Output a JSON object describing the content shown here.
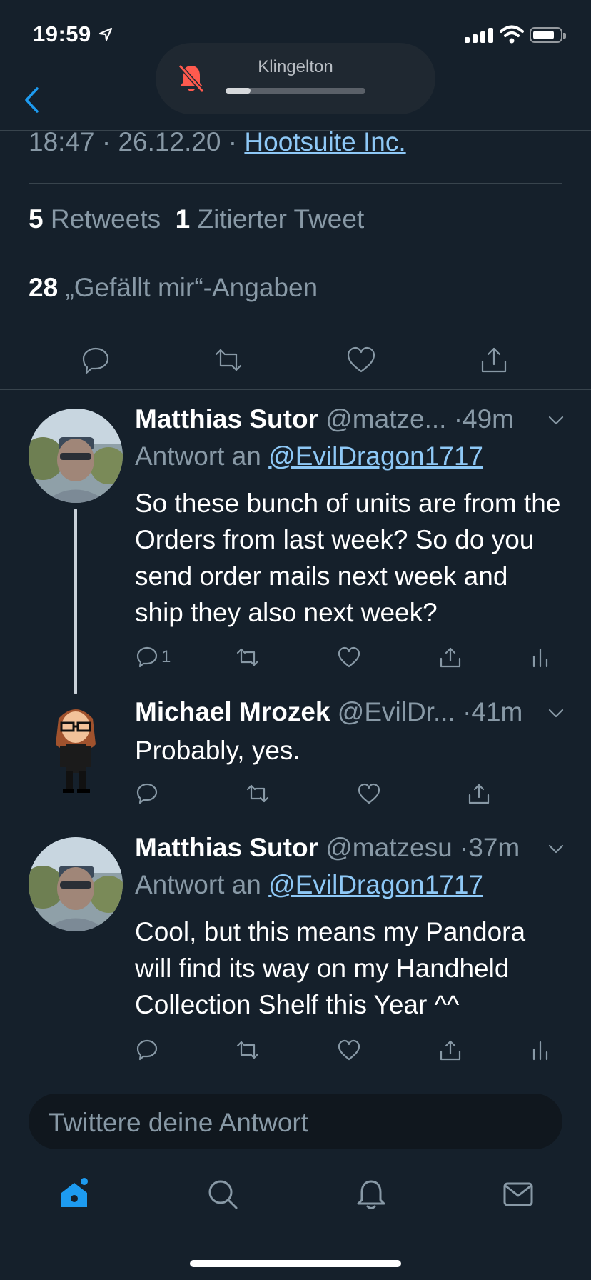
{
  "status_bar": {
    "time": "19:59",
    "battery_level": 0.75
  },
  "ringer": {
    "label": "Klingelton",
    "level": 0.18
  },
  "tweet_meta": {
    "time": "18:47",
    "separator": "·",
    "date": "26.12.20",
    "source": "Hootsuite Inc."
  },
  "stats": {
    "retweets_count": "5",
    "retweets_label": "Retweets",
    "quotes_count": "1",
    "quotes_label": "Zitierter Tweet",
    "likes_count": "28",
    "likes_label": "„Gefällt mir“-Angaben"
  },
  "replies": [
    {
      "name": "Matthias Sutor",
      "handle": "@matze...",
      "dot": "·",
      "time": "49m",
      "replying_prefix": "Antwort an",
      "replying_to": "@EvilDragon1717",
      "text": "So these bunch of units are from the Orders from last week? So do you send order mails next week and ship they also next week?",
      "reply_count": "1"
    },
    {
      "name": "Michael Mrozek",
      "handle": "@EvilDr...",
      "dot": "·",
      "time": "41m",
      "text": "Probably, yes."
    },
    {
      "name": "Matthias Sutor",
      "handle": "@matzesu",
      "dot": "·",
      "time": "37m",
      "replying_prefix": "Antwort an",
      "replying_to": "@EvilDragon1717",
      "text": "Cool, but this means my Pandora will find its way on my Handheld Collection Shelf this Year ^^"
    }
  ],
  "compose": {
    "placeholder": "Twittere deine Antwort"
  },
  "tab_bar": [
    "home-icon",
    "search-icon",
    "notifications-icon",
    "messages-icon"
  ],
  "colors": {
    "background": "#15202b",
    "accent": "#1d9bf0",
    "muted": "#8899a6",
    "link": "#8ec8f6",
    "ringer_mute": "#ff5a4e"
  }
}
